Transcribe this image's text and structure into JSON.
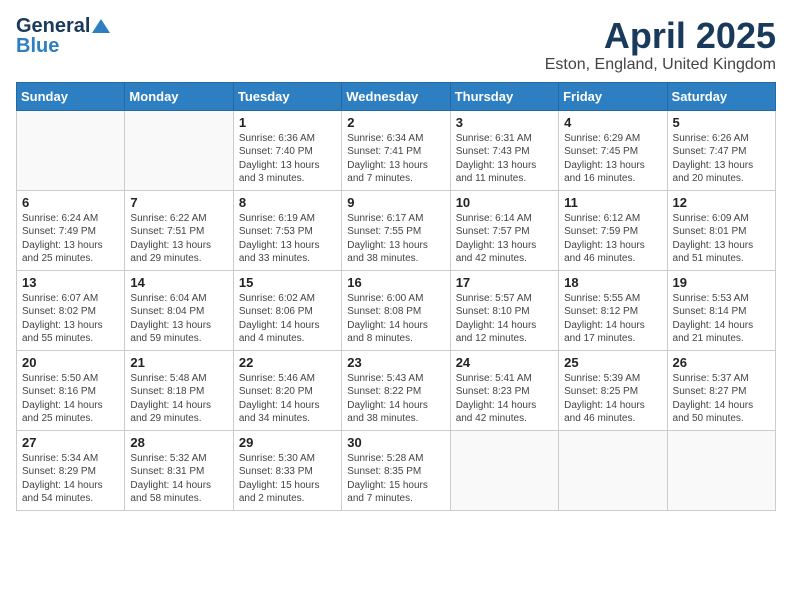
{
  "header": {
    "logo_general": "General",
    "logo_blue": "Blue",
    "month_title": "April 2025",
    "location": "Eston, England, United Kingdom"
  },
  "days_of_week": [
    "Sunday",
    "Monday",
    "Tuesday",
    "Wednesday",
    "Thursday",
    "Friday",
    "Saturday"
  ],
  "weeks": [
    [
      {
        "day": "",
        "info": ""
      },
      {
        "day": "",
        "info": ""
      },
      {
        "day": "1",
        "info": "Sunrise: 6:36 AM\nSunset: 7:40 PM\nDaylight: 13 hours and 3 minutes."
      },
      {
        "day": "2",
        "info": "Sunrise: 6:34 AM\nSunset: 7:41 PM\nDaylight: 13 hours and 7 minutes."
      },
      {
        "day": "3",
        "info": "Sunrise: 6:31 AM\nSunset: 7:43 PM\nDaylight: 13 hours and 11 minutes."
      },
      {
        "day": "4",
        "info": "Sunrise: 6:29 AM\nSunset: 7:45 PM\nDaylight: 13 hours and 16 minutes."
      },
      {
        "day": "5",
        "info": "Sunrise: 6:26 AM\nSunset: 7:47 PM\nDaylight: 13 hours and 20 minutes."
      }
    ],
    [
      {
        "day": "6",
        "info": "Sunrise: 6:24 AM\nSunset: 7:49 PM\nDaylight: 13 hours and 25 minutes."
      },
      {
        "day": "7",
        "info": "Sunrise: 6:22 AM\nSunset: 7:51 PM\nDaylight: 13 hours and 29 minutes."
      },
      {
        "day": "8",
        "info": "Sunrise: 6:19 AM\nSunset: 7:53 PM\nDaylight: 13 hours and 33 minutes."
      },
      {
        "day": "9",
        "info": "Sunrise: 6:17 AM\nSunset: 7:55 PM\nDaylight: 13 hours and 38 minutes."
      },
      {
        "day": "10",
        "info": "Sunrise: 6:14 AM\nSunset: 7:57 PM\nDaylight: 13 hours and 42 minutes."
      },
      {
        "day": "11",
        "info": "Sunrise: 6:12 AM\nSunset: 7:59 PM\nDaylight: 13 hours and 46 minutes."
      },
      {
        "day": "12",
        "info": "Sunrise: 6:09 AM\nSunset: 8:01 PM\nDaylight: 13 hours and 51 minutes."
      }
    ],
    [
      {
        "day": "13",
        "info": "Sunrise: 6:07 AM\nSunset: 8:02 PM\nDaylight: 13 hours and 55 minutes."
      },
      {
        "day": "14",
        "info": "Sunrise: 6:04 AM\nSunset: 8:04 PM\nDaylight: 13 hours and 59 minutes."
      },
      {
        "day": "15",
        "info": "Sunrise: 6:02 AM\nSunset: 8:06 PM\nDaylight: 14 hours and 4 minutes."
      },
      {
        "day": "16",
        "info": "Sunrise: 6:00 AM\nSunset: 8:08 PM\nDaylight: 14 hours and 8 minutes."
      },
      {
        "day": "17",
        "info": "Sunrise: 5:57 AM\nSunset: 8:10 PM\nDaylight: 14 hours and 12 minutes."
      },
      {
        "day": "18",
        "info": "Sunrise: 5:55 AM\nSunset: 8:12 PM\nDaylight: 14 hours and 17 minutes."
      },
      {
        "day": "19",
        "info": "Sunrise: 5:53 AM\nSunset: 8:14 PM\nDaylight: 14 hours and 21 minutes."
      }
    ],
    [
      {
        "day": "20",
        "info": "Sunrise: 5:50 AM\nSunset: 8:16 PM\nDaylight: 14 hours and 25 minutes."
      },
      {
        "day": "21",
        "info": "Sunrise: 5:48 AM\nSunset: 8:18 PM\nDaylight: 14 hours and 29 minutes."
      },
      {
        "day": "22",
        "info": "Sunrise: 5:46 AM\nSunset: 8:20 PM\nDaylight: 14 hours and 34 minutes."
      },
      {
        "day": "23",
        "info": "Sunrise: 5:43 AM\nSunset: 8:22 PM\nDaylight: 14 hours and 38 minutes."
      },
      {
        "day": "24",
        "info": "Sunrise: 5:41 AM\nSunset: 8:23 PM\nDaylight: 14 hours and 42 minutes."
      },
      {
        "day": "25",
        "info": "Sunrise: 5:39 AM\nSunset: 8:25 PM\nDaylight: 14 hours and 46 minutes."
      },
      {
        "day": "26",
        "info": "Sunrise: 5:37 AM\nSunset: 8:27 PM\nDaylight: 14 hours and 50 minutes."
      }
    ],
    [
      {
        "day": "27",
        "info": "Sunrise: 5:34 AM\nSunset: 8:29 PM\nDaylight: 14 hours and 54 minutes."
      },
      {
        "day": "28",
        "info": "Sunrise: 5:32 AM\nSunset: 8:31 PM\nDaylight: 14 hours and 58 minutes."
      },
      {
        "day": "29",
        "info": "Sunrise: 5:30 AM\nSunset: 8:33 PM\nDaylight: 15 hours and 2 minutes."
      },
      {
        "day": "30",
        "info": "Sunrise: 5:28 AM\nSunset: 8:35 PM\nDaylight: 15 hours and 7 minutes."
      },
      {
        "day": "",
        "info": ""
      },
      {
        "day": "",
        "info": ""
      },
      {
        "day": "",
        "info": ""
      }
    ]
  ]
}
